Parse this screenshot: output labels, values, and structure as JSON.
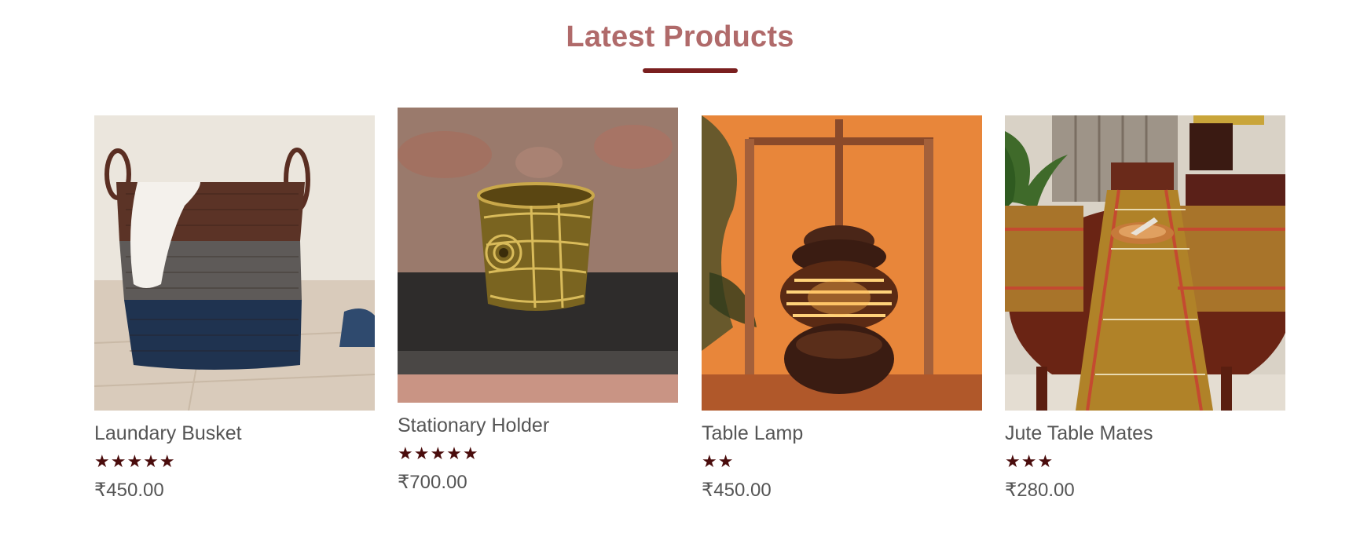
{
  "section": {
    "title": "Latest Products"
  },
  "products": [
    {
      "name": "Laundary Busket",
      "stars": "★★★★★",
      "rating": 5,
      "price": "₹450.00",
      "image_icon": "laundry-basket-image"
    },
    {
      "name": "Stationary Holder",
      "stars": "★★★★★",
      "rating": 5,
      "price": "₹700.00",
      "image_icon": "pen-holder-image"
    },
    {
      "name": "Table Lamp",
      "stars": "★★",
      "rating": 2,
      "price": "₹450.00",
      "image_icon": "table-lamp-image"
    },
    {
      "name": "Jute Table Mates",
      "stars": "★★★",
      "rating": 3,
      "price": "₹280.00",
      "image_icon": "table-mats-image"
    }
  ],
  "colors": {
    "title": "#b06a6a",
    "underline": "#7a1f1f",
    "stars": "#4a0c0c",
    "text": "#555555"
  }
}
